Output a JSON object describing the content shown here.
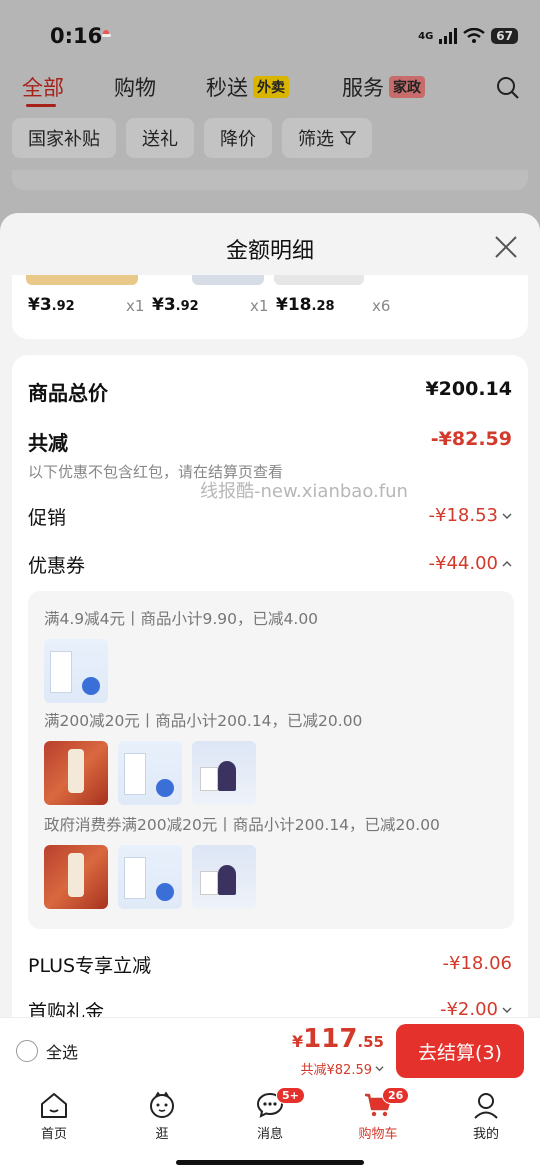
{
  "status_bar": {
    "time": "0:16",
    "network": "4G",
    "battery": "67"
  },
  "top_tabs": [
    {
      "label": "全部",
      "active": true
    },
    {
      "label": "购物"
    },
    {
      "label": "秒送",
      "badge": "外卖"
    },
    {
      "label": "服务",
      "badge": "家政"
    }
  ],
  "filters": [
    "国家补贴",
    "送礼",
    "降价",
    "筛选"
  ],
  "sheet": {
    "title": "金额明细",
    "items": [
      {
        "price_int": "¥3",
        "price_dec": ".92",
        "qty": "x1"
      },
      {
        "price_int": "¥3",
        "price_dec": ".92",
        "qty": "x1"
      },
      {
        "price_int": "¥18",
        "price_dec": ".28",
        "qty": "x6"
      }
    ],
    "summary": {
      "total_label": "商品总价",
      "total_value": "¥200.14",
      "reduce_label": "共减",
      "reduce_value": "-¥82.59",
      "reduce_hint": "以下优惠不包含红包，请在结算页查看",
      "promo_label": "促销",
      "promo_value": "-¥18.53",
      "coupon_label": "优惠券",
      "coupon_value": "-¥44.00",
      "plus_label": "PLUS专享立减",
      "plus_value": "-¥18.06",
      "first_label": "首购礼金",
      "first_value": "-¥2.00"
    },
    "coupons": [
      {
        "text": "满4.9减4元丨商品小计9.90，已减4.00"
      },
      {
        "text": "满200减20元丨商品小计200.14，已减20.00"
      },
      {
        "text": "政府消费券满200减20元丨商品小计200.14，已减20.00"
      }
    ],
    "watermark": "线报酷-new.xianbao.fun"
  },
  "checkout": {
    "select_all": "全选",
    "yen": "¥",
    "price_int": "117",
    "price_dec": ".55",
    "discount": "共减¥82.59",
    "button": "去结算(3)"
  },
  "tabbar": [
    {
      "label": "首页",
      "icon": "home-icon"
    },
    {
      "label": "逛",
      "icon": "browse-icon"
    },
    {
      "label": "消息",
      "icon": "message-icon",
      "badge": "5+"
    },
    {
      "label": "购物车",
      "icon": "cart-icon",
      "badge": "26",
      "active": true
    },
    {
      "label": "我的",
      "icon": "profile-icon"
    }
  ],
  "colors": {
    "accent": "#e4312b",
    "discount": "#d33a2c",
    "brand_tab": "#a8201a"
  }
}
